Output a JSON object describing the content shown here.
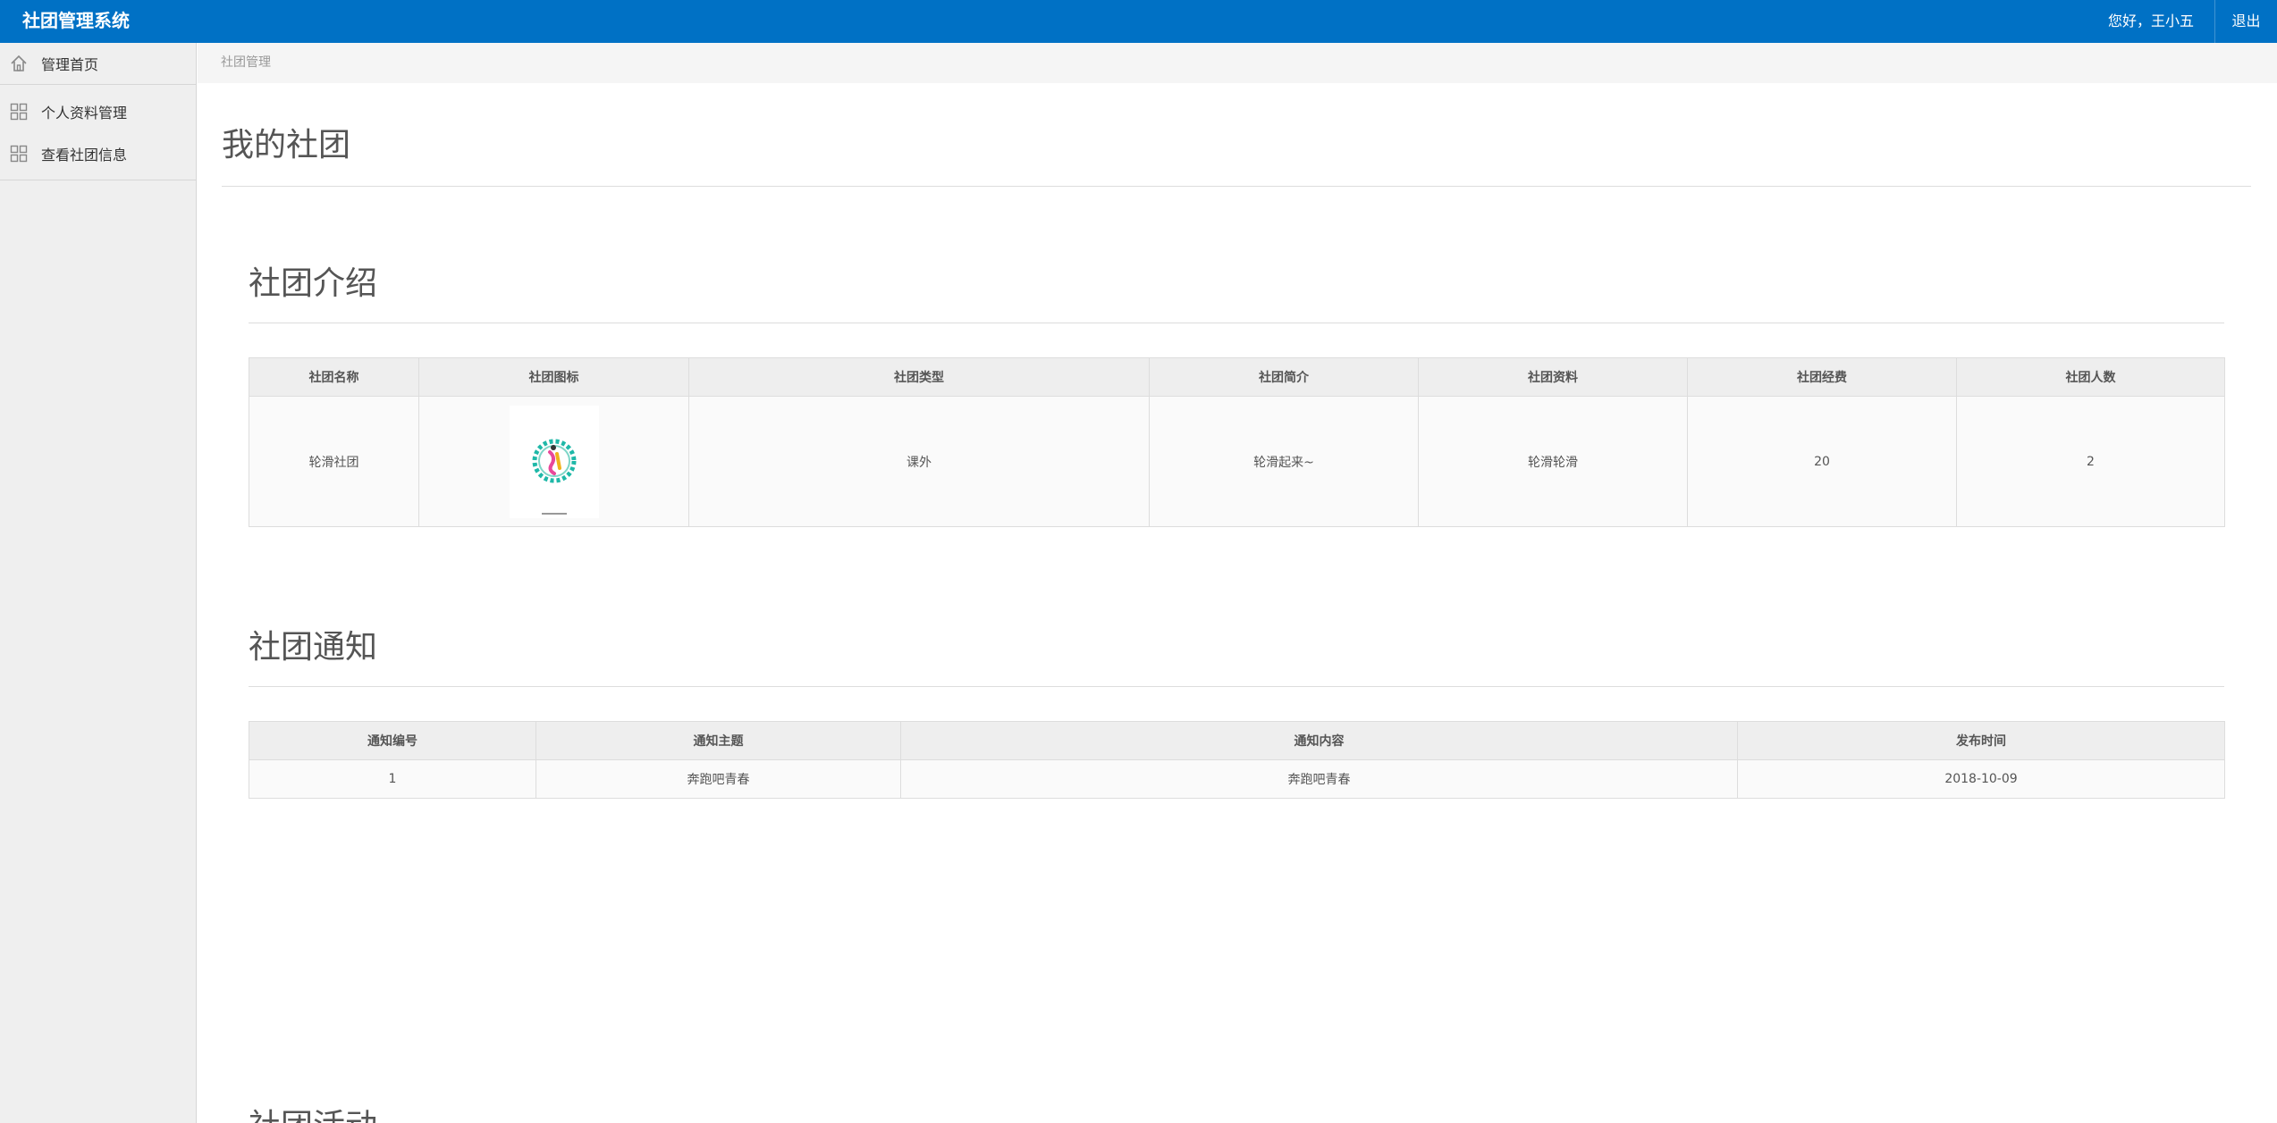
{
  "header": {
    "app_title": "社团管理系统",
    "greeting": "您好，王小五",
    "logout": "退出"
  },
  "sidebar": {
    "home": {
      "label": "管理首页",
      "icon": "home-icon"
    },
    "items": [
      {
        "label": "个人资料管理",
        "icon": "grid-icon"
      },
      {
        "label": "查看社团信息",
        "icon": "grid-icon"
      }
    ]
  },
  "breadcrumb": "社团管理",
  "main": {
    "page_title": "我的社团",
    "intro": {
      "title": "社团介绍",
      "headers": [
        "社团名称",
        "社团图标",
        "社团类型",
        "社团简介",
        "社团资料",
        "社团经费",
        "社团人数"
      ],
      "row": {
        "name": "轮滑社团",
        "logo_icon": "club-logo-image",
        "type": "课外",
        "summary": "轮滑起来~",
        "material": "轮滑轮滑",
        "funds": "20",
        "members": "2"
      }
    },
    "notices": {
      "title": "社团通知",
      "headers": [
        "通知编号",
        "通知主题",
        "通知内容",
        "发布时间"
      ],
      "rows": [
        {
          "id": "1",
          "subject": "奔跑吧青春",
          "content": "奔跑吧青春",
          "date": "2018-10-09"
        }
      ]
    },
    "activities": {
      "title": "社团活动"
    }
  },
  "colors": {
    "topbar": "#0071c5",
    "sidebar_bg": "#efefef",
    "table_header_bg": "#eeeeee"
  }
}
